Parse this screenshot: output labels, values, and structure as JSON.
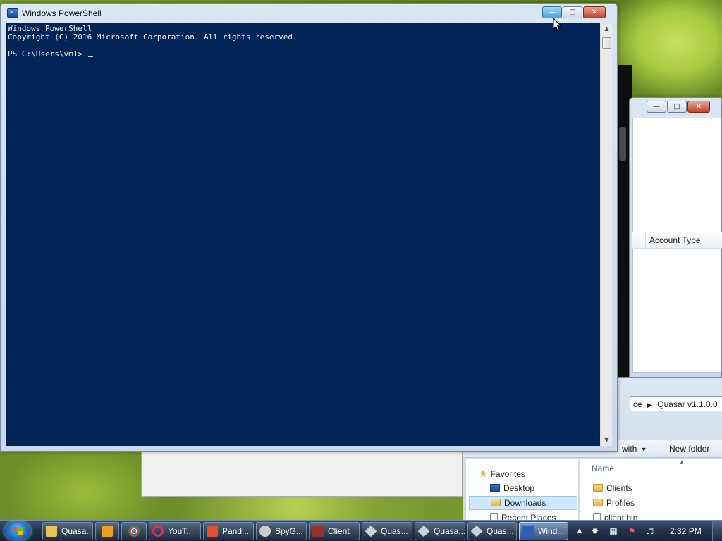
{
  "powershell": {
    "title": "Windows PowerShell",
    "icon": "powershell-icon",
    "lines": [
      "Windows PowerShell",
      "Copyright (C) 2016 Microsoft Corporation. All rights reserved.",
      "",
      "PS C:\\Users\\vm1> "
    ]
  },
  "back_window": {
    "column_header": "Account Type"
  },
  "explorer": {
    "address_segments": [
      "ce",
      "Quasar v1.1.0.0"
    ],
    "toolbar": {
      "open_with": "with",
      "new_folder": "New folder"
    },
    "nav": {
      "favorites": "Favorites",
      "desktop": "Desktop",
      "downloads": "Downloads",
      "recent_places": "Recent Places"
    },
    "list_header": "Name",
    "items": [
      "Clients",
      "Profiles",
      "client.bin"
    ]
  },
  "taskbar": {
    "buttons": [
      {
        "label": "Quasa...",
        "icon": "folder-icon",
        "color": "#e7c35a"
      },
      {
        "label": "",
        "icon": "media-player-icon",
        "color": "#f0a020"
      },
      {
        "label": "",
        "icon": "chrome-icon",
        "color": "#db4437"
      },
      {
        "label": "YouT...",
        "icon": "opera-icon",
        "color": "#e0304a"
      },
      {
        "label": "Pand...",
        "icon": "panda-icon",
        "color": "#e05030"
      },
      {
        "label": "SpyG...",
        "icon": "spy-icon",
        "color": "#cccccc"
      },
      {
        "label": "Client",
        "icon": "client-icon",
        "color": "#9a3030"
      },
      {
        "label": "Quas...",
        "icon": "quasar-icon",
        "color": "#c8d0dc"
      },
      {
        "label": "Quasa...",
        "icon": "quasar-icon",
        "color": "#c8d0dc"
      },
      {
        "label": "Quas...",
        "icon": "quasar-icon",
        "color": "#c8d0dc"
      },
      {
        "label": "Wind...",
        "icon": "powershell-icon",
        "color": "#2a5fb8"
      }
    ],
    "clock": "2:32 PM"
  }
}
